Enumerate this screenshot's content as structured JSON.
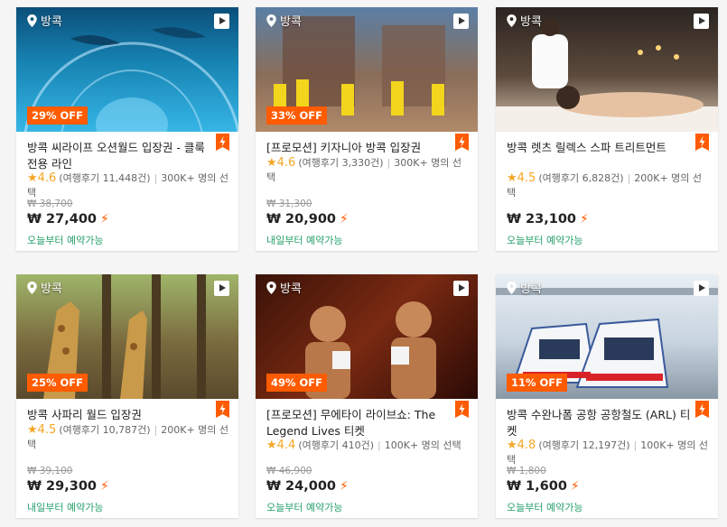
{
  "colors": {
    "accent": "#ff5b00",
    "rating": "#f5a623",
    "availability": "#26a06b"
  },
  "icons": {
    "location": "map-pin-icon",
    "video": "play-icon",
    "flash": "lightning-icon",
    "rating": "star-icon",
    "instant": "bolt-icon"
  },
  "cards": [
    {
      "location": "방콕",
      "discount": "29% OFF",
      "title": "방콕 씨라이프 오션월드 입장권 - 클룩 전용 라인",
      "score": "4.6",
      "reviews": "(여행후기 11,448건)",
      "booked": "300K+ 명의 선택",
      "original_price": "₩ 38,700",
      "price": "₩ 27,400",
      "availability": "오늘부터 예약가능"
    },
    {
      "location": "방콕",
      "discount": "33% OFF",
      "title": "[프로모션] 키자니아 방콕 입장권",
      "score": "4.6",
      "reviews": "(여행후기 3,330건)",
      "booked": "300K+ 명의 선택",
      "original_price": "₩ 31,300",
      "price": "₩ 20,900",
      "availability": "내일부터 예약가능"
    },
    {
      "location": "방콕",
      "discount": "",
      "title": "방콕 렛츠 릴렉스 스파 트리트먼트",
      "score": "4.5",
      "reviews": "(여행후기 6,828건)",
      "booked": "200K+ 명의 선택",
      "original_price": "",
      "price": "₩ 23,100",
      "availability": "오늘부터 예약가능"
    },
    {
      "location": "방콕",
      "discount": "25% OFF",
      "title": "방콕 사파리 월드 입장권",
      "score": "4.5",
      "reviews": "(여행후기 10,787건)",
      "booked": "200K+ 명의 선택",
      "original_price": "₩ 39,100",
      "price": "₩ 29,300",
      "availability": "내일부터 예약가능"
    },
    {
      "location": "방콕",
      "discount": "49% OFF",
      "title": "[프로모션] 무에타이 라이브쇼: The Legend Lives 티켓",
      "score": "4.4",
      "reviews": "(여행후기 410건)",
      "booked": "100K+ 명의 선택",
      "original_price": "₩ 46,900",
      "price": "₩ 24,000",
      "availability": "오늘부터 예약가능"
    },
    {
      "location": "방콕",
      "discount": "11% OFF",
      "title": "방콕 수완나폼 공항 공항철도 (ARL) 티켓",
      "score": "4.8",
      "reviews": "(여행후기 12,197건)",
      "booked": "100K+ 명의 선택",
      "original_price": "₩ 1,800",
      "price": "₩ 1,600",
      "availability": "오늘부터 예약가능"
    }
  ]
}
